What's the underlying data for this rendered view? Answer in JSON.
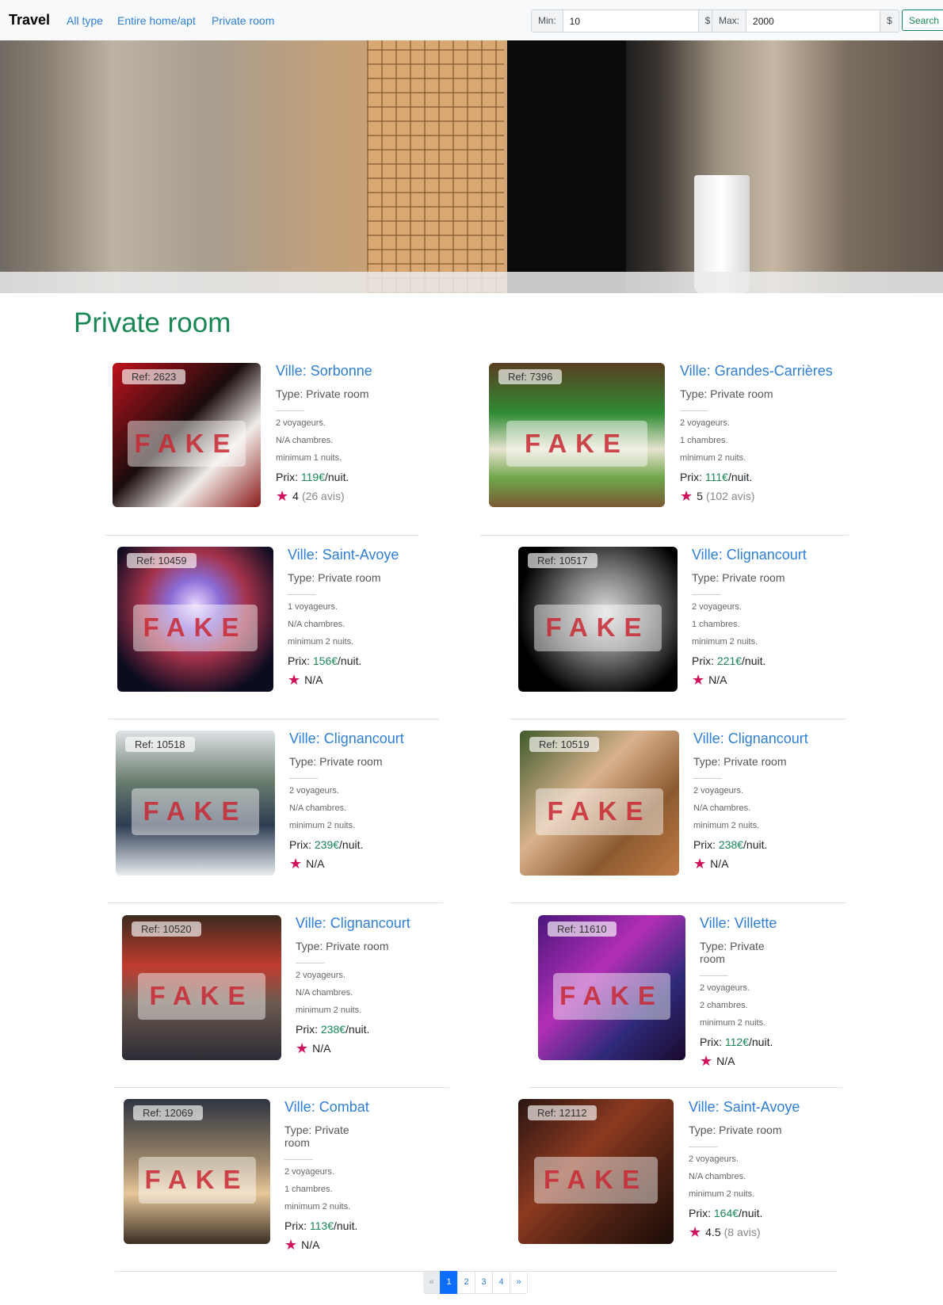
{
  "nav": {
    "brand": "Travel",
    "links": [
      "All type",
      "Entire home/apt",
      "Private room"
    ],
    "min_label": "Min:",
    "min_value": "10",
    "currency": "$",
    "max_label": "Max:",
    "max_value": "2000",
    "search_label": "Search"
  },
  "heading": "Private room",
  "listings": [
    {
      "ref": "Ref: 2623",
      "fake": "FAKE",
      "title": "Ville: Sorbonne",
      "type": "Type: Private room",
      "voyageurs": "2 voyageurs.",
      "chambres": "N/A chambres.",
      "nuits": "minimum 1 nuits.",
      "price_prefix": "Prix: ",
      "price": "119€",
      "price_suffix": "/nuit.",
      "rating": "4",
      "reviews": "(26 avis)"
    },
    {
      "ref": "Ref: 7396",
      "fake": "FAKE",
      "title": "Ville: Grandes-Carrières",
      "type": "Type: Private room",
      "voyageurs": "2 voyageurs.",
      "chambres": "1 chambres.",
      "nuits": "minimum 2 nuits.",
      "price_prefix": "Prix: ",
      "price": "111€",
      "price_suffix": "/nuit.",
      "rating": "5",
      "reviews": "(102 avis)"
    },
    {
      "ref": "Ref: 10459",
      "fake": "FAKE",
      "title": "Ville: Saint-Avoye",
      "type": "Type: Private room",
      "voyageurs": "1 voyageurs.",
      "chambres": "N/A chambres.",
      "nuits": "minimum 2 nuits.",
      "price_prefix": "Prix: ",
      "price": "156€",
      "price_suffix": "/nuit.",
      "rating": "N/A",
      "reviews": ""
    },
    {
      "ref": "Ref: 10517",
      "fake": "FAKE",
      "title": "Ville: Clignancourt",
      "type": "Type: Private room",
      "voyageurs": "2 voyageurs.",
      "chambres": "1 chambres.",
      "nuits": "minimum 2 nuits.",
      "price_prefix": "Prix: ",
      "price": "221€",
      "price_suffix": "/nuit.",
      "rating": "N/A",
      "reviews": ""
    },
    {
      "ref": "Ref: 10518",
      "fake": "FAKE",
      "title": "Ville: Clignancourt",
      "type": "Type: Private room",
      "voyageurs": "2 voyageurs.",
      "chambres": "N/A chambres.",
      "nuits": "minimum 2 nuits.",
      "price_prefix": "Prix: ",
      "price": "239€",
      "price_suffix": "/nuit.",
      "rating": "N/A",
      "reviews": ""
    },
    {
      "ref": "Ref: 10519",
      "fake": "FAKE",
      "title": "Ville: Clignancourt",
      "type": "Type: Private room",
      "voyageurs": "2 voyageurs.",
      "chambres": "N/A chambres.",
      "nuits": "minimum 2 nuits.",
      "price_prefix": "Prix: ",
      "price": "238€",
      "price_suffix": "/nuit.",
      "rating": "N/A",
      "reviews": ""
    },
    {
      "ref": "Ref: 10520",
      "fake": "FAKE",
      "title": "Ville: Clignancourt",
      "type": "Type: Private room",
      "voyageurs": "2 voyageurs.",
      "chambres": "N/A chambres.",
      "nuits": "minimum 2 nuits.",
      "price_prefix": "Prix: ",
      "price": "238€",
      "price_suffix": "/nuit.",
      "rating": "N/A",
      "reviews": ""
    },
    {
      "ref": "Ref: 11610",
      "fake": "FAKE",
      "title": "Ville: Villette",
      "type": "Type: Private room",
      "voyageurs": "2 voyageurs.",
      "chambres": "2 chambres.",
      "nuits": "minimum 2 nuits.",
      "price_prefix": "Prix: ",
      "price": "112€",
      "price_suffix": "/nuit.",
      "rating": "N/A",
      "reviews": ""
    },
    {
      "ref": "Ref: 12069",
      "fake": "FAKE",
      "title": "Ville: Combat",
      "type": "Type: Private room",
      "voyageurs": "2 voyageurs.",
      "chambres": "1 chambres.",
      "nuits": "minimum 2 nuits.",
      "price_prefix": "Prix: ",
      "price": "113€",
      "price_suffix": "/nuit.",
      "rating": "N/A",
      "reviews": ""
    },
    {
      "ref": "Ref: 12112",
      "fake": "FAKE",
      "title": "Ville: Saint-Avoye",
      "type": "Type: Private room",
      "voyageurs": "2 voyageurs.",
      "chambres": "N/A chambres.",
      "nuits": "minimum 2 nuits.",
      "price_prefix": "Prix: ",
      "price": "164€",
      "price_suffix": "/nuit.",
      "rating": "4.5",
      "reviews": "(8 avis)"
    }
  ],
  "pagination": [
    "«",
    "1",
    "2",
    "3",
    "4",
    "»"
  ],
  "colors": {
    "accent": "#198754",
    "link": "#2f7fd4",
    "star": "#d0115c",
    "active_page": "#0d6efd"
  }
}
